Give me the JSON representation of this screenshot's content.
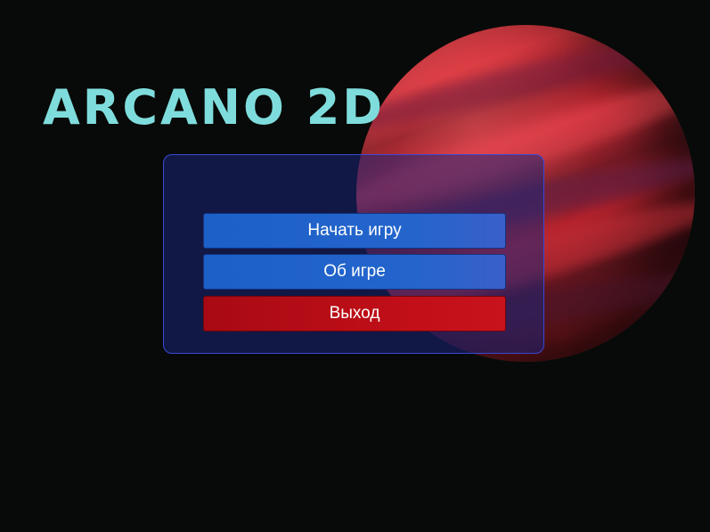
{
  "game": {
    "title": "ARCANO 2D"
  },
  "menu": {
    "buttons": [
      {
        "id": "start",
        "label": "Начать игру"
      },
      {
        "id": "about",
        "label": "Об игре"
      },
      {
        "id": "exit",
        "label": "Выход"
      }
    ]
  },
  "colors": {
    "background": "#070a08",
    "title": "#7fdcdc",
    "panel_border": "#3a48d6",
    "button_primary": "#2465cc",
    "button_danger": "#c20f18",
    "planet": "#c72a34"
  },
  "icons": {
    "decoration": "planet"
  }
}
